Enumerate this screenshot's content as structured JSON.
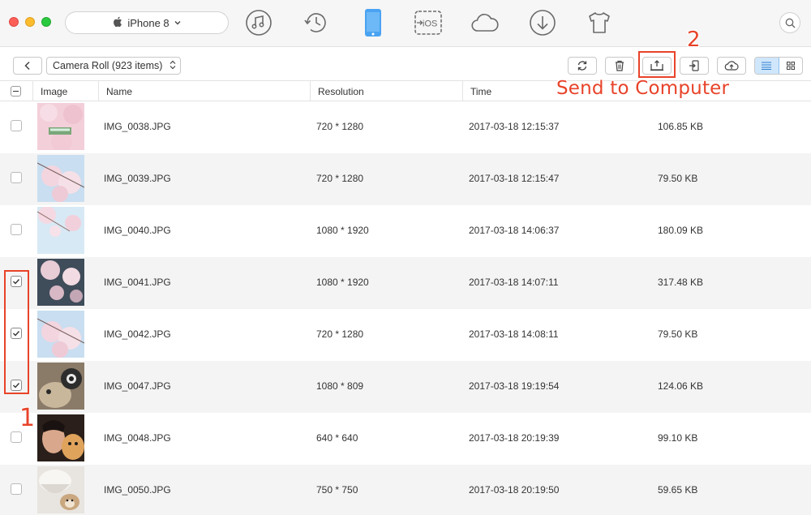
{
  "device": {
    "name": "iPhone 8"
  },
  "nav": [
    {
      "id": "music",
      "icon": "music-note-icon"
    },
    {
      "id": "backup",
      "icon": "history-clock-icon"
    },
    {
      "id": "device",
      "icon": "phone-icon",
      "active": true,
      "accent": "#4aa3f2"
    },
    {
      "id": "to-ios",
      "icon": "transfer-to-ios-icon",
      "label": "iOS"
    },
    {
      "id": "icloud",
      "icon": "cloud-icon"
    },
    {
      "id": "download",
      "icon": "download-icon"
    },
    {
      "id": "toolkit",
      "icon": "tshirt-icon"
    }
  ],
  "toolbar": {
    "album_label": "Camera Roll (923 items)",
    "buttons": [
      "refresh-icon",
      "trash-icon",
      "send-to-computer-icon",
      "add-to-device-icon",
      "upload-cloud-icon"
    ],
    "view_modes": [
      "list-view-icon",
      "grid-view-icon"
    ]
  },
  "annotations": {
    "step1": "1",
    "step2": "2",
    "send_label": "Send to Computer",
    "color": "#e8432a"
  },
  "table": {
    "columns": [
      "Image",
      "Name",
      "Resolution",
      "Time"
    ],
    "rows": [
      {
        "checked": false,
        "name": "IMG_0038.JPG",
        "resolution": "720 * 1280",
        "time": "2017-03-18 12:15:37",
        "size": "106.85 KB",
        "thumb": "pink-blossom-train"
      },
      {
        "checked": false,
        "name": "IMG_0039.JPG",
        "resolution": "720 * 1280",
        "time": "2017-03-18 12:15:47",
        "size": "79.50 KB",
        "thumb": "blossom-sky"
      },
      {
        "checked": false,
        "name": "IMG_0040.JPG",
        "resolution": "1080 * 1920",
        "time": "2017-03-18 14:06:37",
        "size": "180.09 KB",
        "thumb": "blossom-light"
      },
      {
        "checked": true,
        "name": "IMG_0041.JPG",
        "resolution": "1080 * 1920",
        "time": "2017-03-18 14:07:11",
        "size": "317.48 KB",
        "thumb": "blossom-dark"
      },
      {
        "checked": true,
        "name": "IMG_0042.JPG",
        "resolution": "720 * 1280",
        "time": "2017-03-18 14:08:11",
        "size": "79.50 KB",
        "thumb": "blossom-sky"
      },
      {
        "checked": true,
        "name": "IMG_0047.JPG",
        "resolution": "1080 * 809",
        "time": "2017-03-18 19:19:54",
        "size": "124.06 KB",
        "thumb": "cat-camera"
      },
      {
        "checked": false,
        "name": "IMG_0048.JPG",
        "resolution": "640 * 640",
        "time": "2017-03-18 20:19:39",
        "size": "99.10 KB",
        "thumb": "person-dog"
      },
      {
        "checked": false,
        "name": "IMG_0050.JPG",
        "resolution": "750 * 750",
        "time": "2017-03-18 20:19:50",
        "size": "59.65 KB",
        "thumb": "cup-hamster"
      }
    ]
  }
}
